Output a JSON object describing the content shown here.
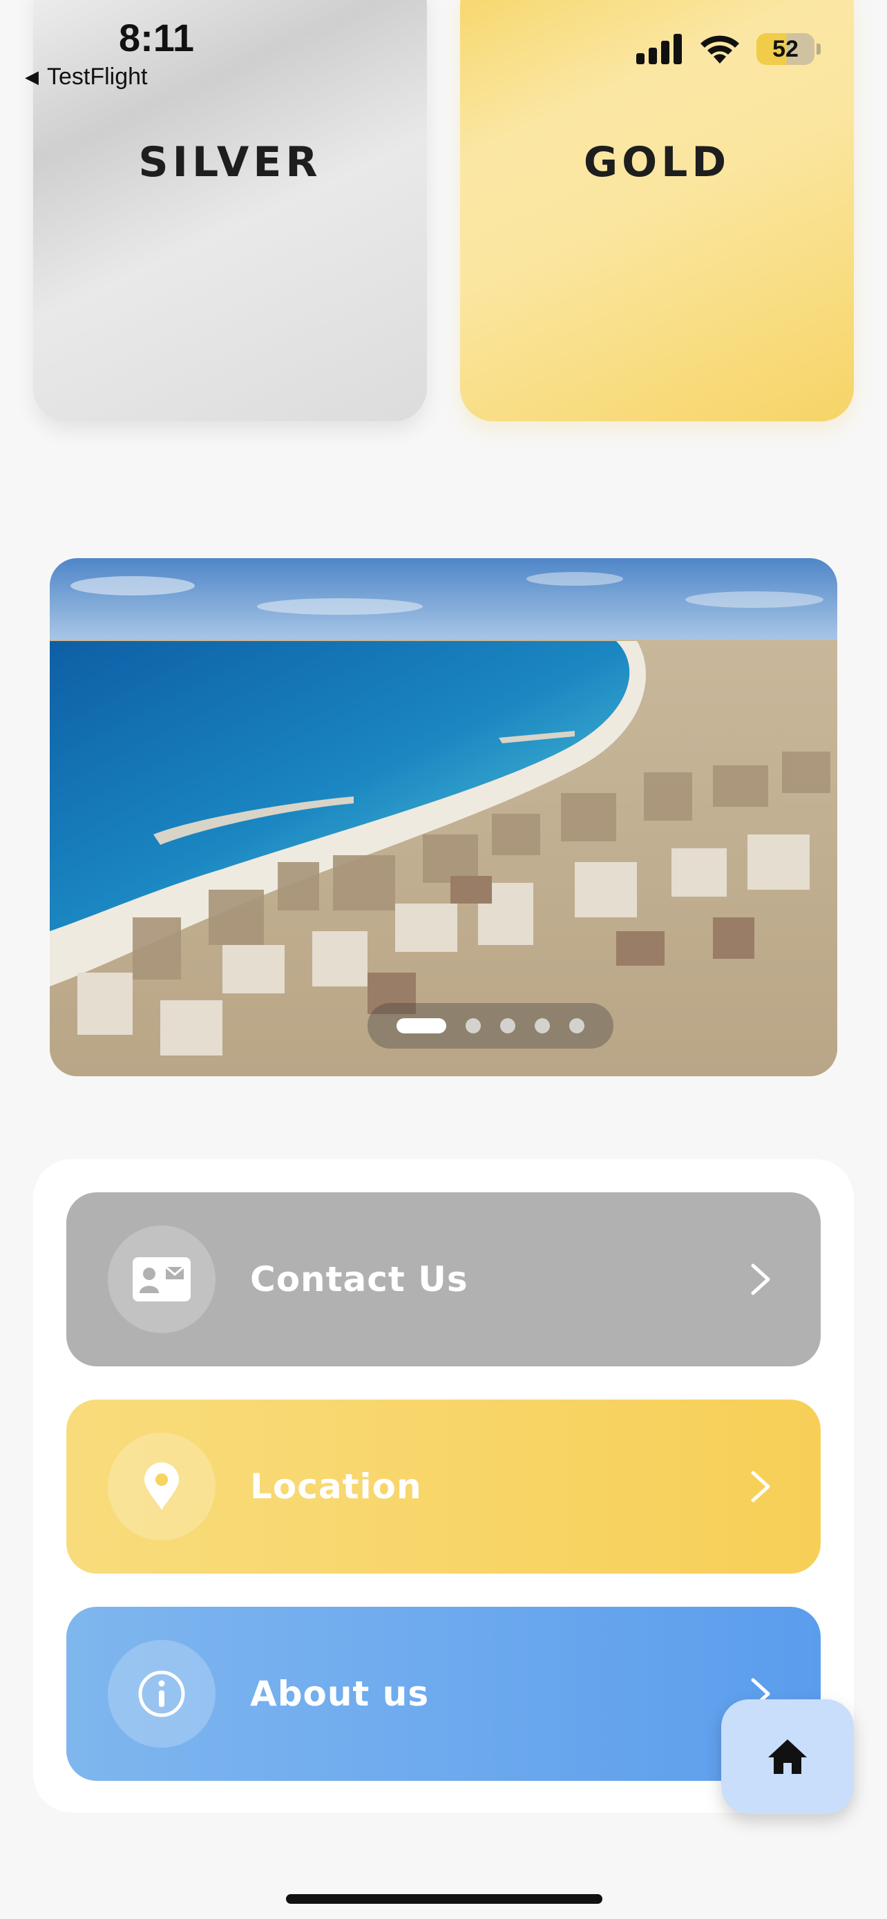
{
  "status_bar": {
    "time": "8:11",
    "back_app": "TestFlight",
    "battery": "52",
    "icons": [
      "cellular-signal-icon",
      "wifi-icon",
      "battery-icon"
    ]
  },
  "tiers": [
    {
      "label": "SILVER",
      "color": "#d6d6d6"
    },
    {
      "label": "GOLD",
      "color": "#f6d566"
    }
  ],
  "carousel": {
    "slide_count": 5,
    "active_index": 0
  },
  "menu": [
    {
      "label": "Contact Us",
      "icon": "contact-card-icon",
      "color": "#b1b1b1"
    },
    {
      "label": "Location",
      "icon": "location-pin-icon",
      "color": "#f7d35f"
    },
    {
      "label": "About us",
      "icon": "info-icon",
      "color": "#6aa7ee"
    }
  ],
  "fab": {
    "icon": "home-icon"
  }
}
